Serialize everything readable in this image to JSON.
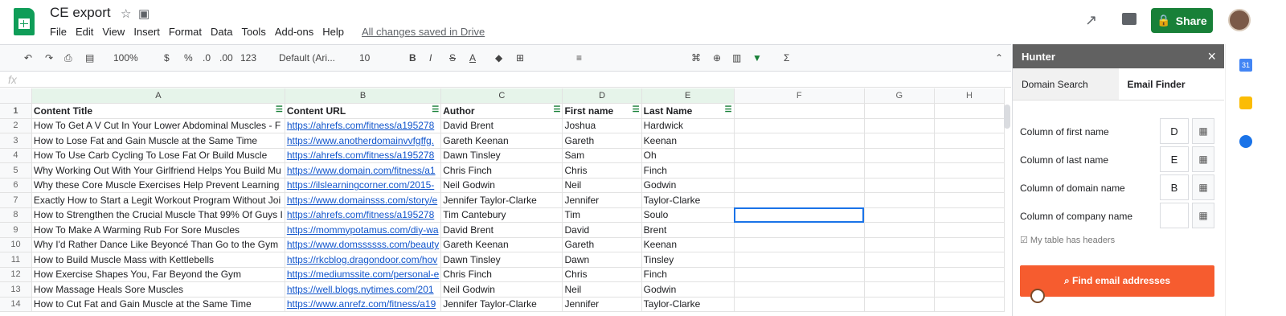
{
  "app": {
    "title": "CE export",
    "saved": "All changes saved in Drive",
    "menu": [
      "File",
      "Edit",
      "View",
      "Insert",
      "Format",
      "Data",
      "Tools",
      "Add-ons",
      "Help"
    ],
    "share": "Share"
  },
  "toolbar": {
    "zoom": "100%",
    "currency": "$",
    "percent": "%",
    "decimal_less": ".0",
    "decimal_more": ".00",
    "format": "123",
    "font": "Default (Ari...",
    "size": "10"
  },
  "sheet": {
    "columns": [
      "A",
      "B",
      "C",
      "D",
      "E",
      "F",
      "G",
      "H"
    ],
    "headers": [
      "Content Title",
      "Content URL",
      "Author",
      "First name",
      "Last Name"
    ],
    "rows": [
      [
        "How To Get A V Cut In Your Lower Abdominal Muscles - F",
        "https://ahrefs.com/fitness/a195278",
        "David Brent",
        "Joshua",
        "Hardwick"
      ],
      [
        "How to Lose Fat and Gain Muscle at the Same Time",
        "https://www.anotherdomainvvfgffg.",
        "Gareth Keenan",
        "Gareth",
        "Keenan"
      ],
      [
        "How To Use Carb Cycling To Lose Fat Or Build Muscle",
        "https://ahrefs.com/fitness/a195278",
        "Dawn Tinsley",
        "Sam",
        "Oh"
      ],
      [
        "Why Working Out With Your Girlfriend Helps You Build Mu",
        "https://www.domain.com/fitness/a1",
        "Chris Finch",
        "Chris",
        "Finch"
      ],
      [
        "Why these Core Muscle Exercises Help Prevent Learning",
        "https://ilslearningcorner.com/2015-",
        "Neil Godwin",
        "Neil",
        "Godwin"
      ],
      [
        "Exactly How to Start a Legit Workout Program Without Joi",
        "https://www.domainsss.com/story/e",
        "Jennifer Taylor-Clarke",
        "Jennifer",
        "Taylor-Clarke"
      ],
      [
        "How to Strengthen the Crucial Muscle That 99% Of Guys I",
        "https://ahrefs.com/fitness/a195278",
        "Tim Cantebury",
        "Tim",
        "Soulo"
      ],
      [
        "How To Make A Warming Rub For Sore Muscles",
        "https://mommypotamus.com/diy-wa",
        "David Brent",
        "David",
        "Brent"
      ],
      [
        "Why I'd Rather Dance Like Beyoncé Than Go to the Gym",
        "https://www.domssssss.com/beauty",
        "Gareth Keenan",
        "Gareth",
        "Keenan"
      ],
      [
        "How to Build Muscle Mass with Kettlebells",
        "https://rkcblog.dragondoor.com/hov",
        "Dawn Tinsley",
        "Dawn",
        "Tinsley"
      ],
      [
        "How Exercise Shapes You, Far Beyond the Gym",
        "https://mediumssite.com/personal-e",
        "Chris Finch",
        "Chris",
        "Finch"
      ],
      [
        "How Massage Heals Sore Muscles",
        "https://well.blogs.nytimes.com/201",
        "Neil Godwin",
        "Neil",
        "Godwin"
      ],
      [
        "How to Cut Fat and Gain Muscle at the Same Time",
        "https://www.anrefz.com/fitness/a19",
        "Jennifer Taylor-Clarke",
        "Jennifer",
        "Taylor-Clarke"
      ]
    ]
  },
  "hunter": {
    "title": "Hunter",
    "tabs": [
      "Domain Search",
      "Email Finder"
    ],
    "fields": [
      {
        "label": "Column of first name",
        "value": "D"
      },
      {
        "label": "Column of last name",
        "value": "E"
      },
      {
        "label": "Column of domain name",
        "value": "B"
      },
      {
        "label": "Column of company name",
        "value": ""
      }
    ],
    "checkbox": "My table has headers",
    "button": "Find email addresses"
  }
}
